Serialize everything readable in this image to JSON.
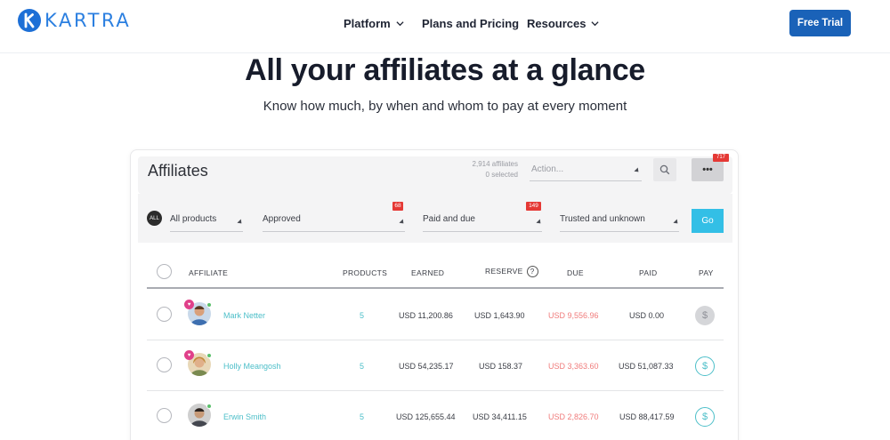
{
  "brand": {
    "name": "KARTRA",
    "accent": "#1d6fd6"
  },
  "nav": {
    "links": [
      {
        "label": "Platform",
        "has_dropdown": true
      },
      {
        "label": "Plans and Pricing",
        "has_dropdown": false
      },
      {
        "label": "Resources",
        "has_dropdown": true
      }
    ],
    "cta_label": "Free Trial"
  },
  "hero": {
    "title": "All your affiliates at a glance",
    "subtitle": "Know how much, by when and whom to pay at every moment"
  },
  "panel": {
    "title": "Affiliates",
    "count_line1": "2,914 affiliates",
    "count_line2": "0 selected",
    "action_placeholder": "Action...",
    "more_badge": "717",
    "filters": [
      {
        "label": "All products",
        "prefix_badge": "ALL"
      },
      {
        "label": "Approved",
        "badge": "68"
      },
      {
        "label": "Paid and due",
        "badge": "149"
      },
      {
        "label": "Trusted and unknown"
      }
    ],
    "go_label": "Go"
  },
  "table": {
    "headers": {
      "affiliate": "AFFILIATE",
      "products": "PRODUCTS",
      "earned": "EARNED",
      "reserve": "RESERVE",
      "reserve_help": "?",
      "due": "DUE",
      "paid": "PAID",
      "pay": "PAY"
    },
    "rows": [
      {
        "name": "Mark Netter",
        "products": "5",
        "earned": "USD 11,200.86",
        "reserve": "USD 1,643.90",
        "due": "USD 9,556.96",
        "paid": "USD 0.00",
        "pay_enabled": false,
        "heart": true
      },
      {
        "name": "Holly Meangosh",
        "products": "5",
        "earned": "USD 54,235.17",
        "reserve": "USD 158.37",
        "due": "USD 3,363.60",
        "paid": "USD 51,087.33",
        "pay_enabled": true,
        "heart": true
      },
      {
        "name": "Erwin Smith",
        "products": "5",
        "earned": "USD 125,655.44",
        "reserve": "USD 34,411.15",
        "due": "USD 2,826.70",
        "paid": "USD 88,417.59",
        "pay_enabled": true,
        "heart": false
      }
    ],
    "pay_symbol": "$"
  }
}
